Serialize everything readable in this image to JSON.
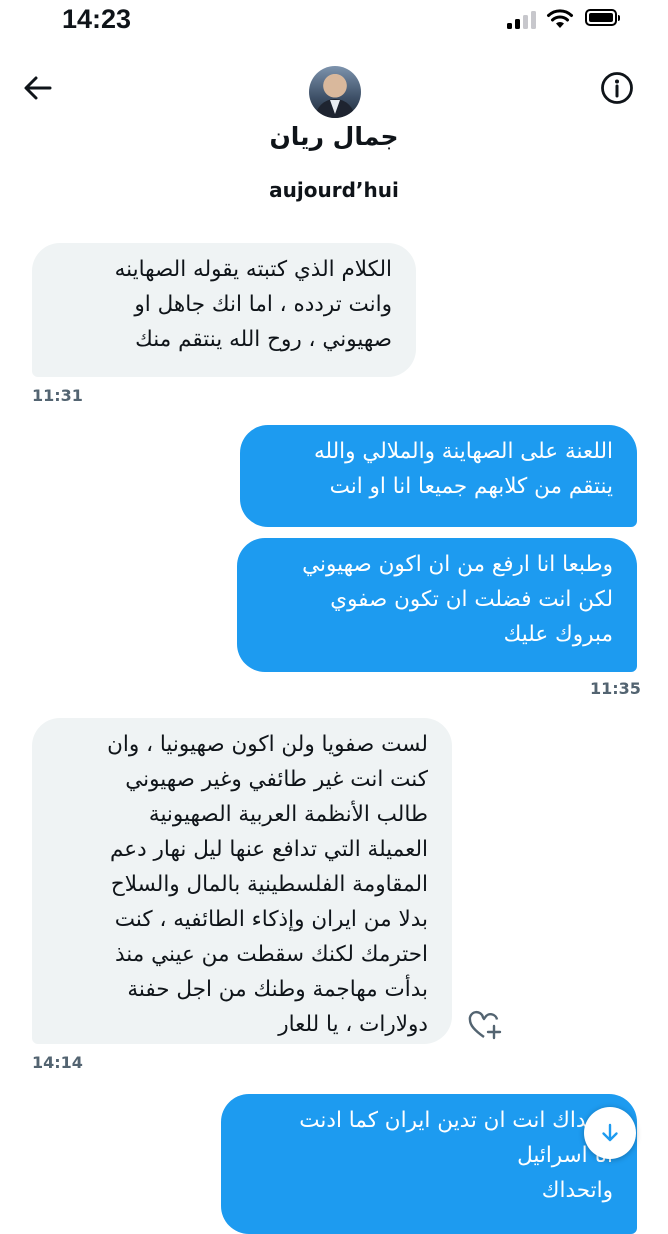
{
  "status_bar": {
    "time": "14:23"
  },
  "header": {
    "contact_name": "جمال ريان"
  },
  "conversation": {
    "date_label": "aujourd’hui",
    "messages": [
      {
        "direction": "incoming",
        "lines": [
          "الكلام الذي كتبته يقوله الصهاينه",
          "وانت تردده ، اما انك جاهل او",
          "صهيوني ، روح الله ينتقم منك"
        ],
        "time": "11:31"
      },
      {
        "direction": "outgoing",
        "lines": [
          "اللعنة على الصهاينة والملالي والله",
          "ينتقم من كلابهم جميعا انا او انت"
        ]
      },
      {
        "direction": "outgoing",
        "lines": [
          "وطبعا انا ارفع من ان اكون صهيوني",
          "لكن انت فضلت ان تكون صفوي",
          "مبروك عليك"
        ],
        "time": "11:35"
      },
      {
        "direction": "incoming",
        "lines": [
          "لست صفويا ولن اكون صهيونيا ، وان",
          "كنت انت غير طائفي وغير صهيوني",
          "طالب الأنظمة العربية الصهيونية",
          "العميلة التي تدافع عنها ليل نهار دعم",
          "المقاومة الفلسطينية بالمال والسلاح",
          "بدلا من ايران وإذكاء الطائفيه ، كنت",
          "احترمك لكنك سقطت من عيني منذ",
          "بدأت مهاجمة وطنك من اجل حفنة",
          "دولارات ، يا للعار"
        ],
        "time": "14:14"
      },
      {
        "direction": "outgoing",
        "lines": [
          "اتحداك انت ان تدين ايران كما ادنت",
          "انا اسرائيل",
          "واتحداك"
        ]
      }
    ]
  },
  "icons": {
    "back": "arrow-left-icon",
    "info": "info-circle-icon",
    "react": "heart-plus-icon",
    "scroll_down": "arrow-down-icon"
  },
  "colors": {
    "outgoing_bubble": "#1d9bf0",
    "incoming_bubble": "#eff3f4",
    "timestamp": "#536471"
  }
}
